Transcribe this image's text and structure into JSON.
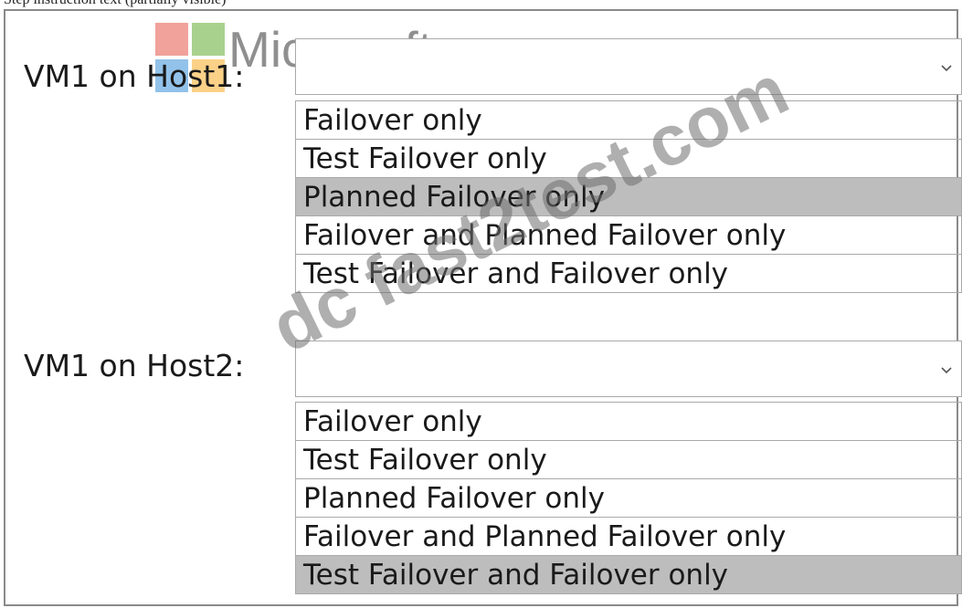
{
  "top_caption": "Step instruction text (partially visible)",
  "logo": {
    "brand_text": "Microsoft"
  },
  "watermark": "dc fast2test.com",
  "questions": [
    {
      "label": "VM1 on Host1:",
      "selected_value": "",
      "options": [
        "Failover only",
        "Test Failover only",
        "Planned Failover only",
        "Failover and Planned Failover only",
        "Test Failover and Failover only"
      ],
      "highlighted_option": "Planned Failover only"
    },
    {
      "label": "VM1 on Host2:",
      "selected_value": "",
      "options": [
        "Failover only",
        "Test Failover only",
        "Planned Failover only",
        "Failover and Planned Failover only",
        "Test Failover and Failover only"
      ],
      "highlighted_option": "Test Failover and Failover only"
    }
  ],
  "icons": {
    "dropdown": "chevron-down-icon"
  },
  "colors": {
    "highlight": "#bdbdbd",
    "border": "#a9a9a9",
    "logo_red": "#f0a29b",
    "logo_green": "#a9d18e",
    "logo_blue": "#92c2ea",
    "logo_yellow": "#fbd188"
  }
}
